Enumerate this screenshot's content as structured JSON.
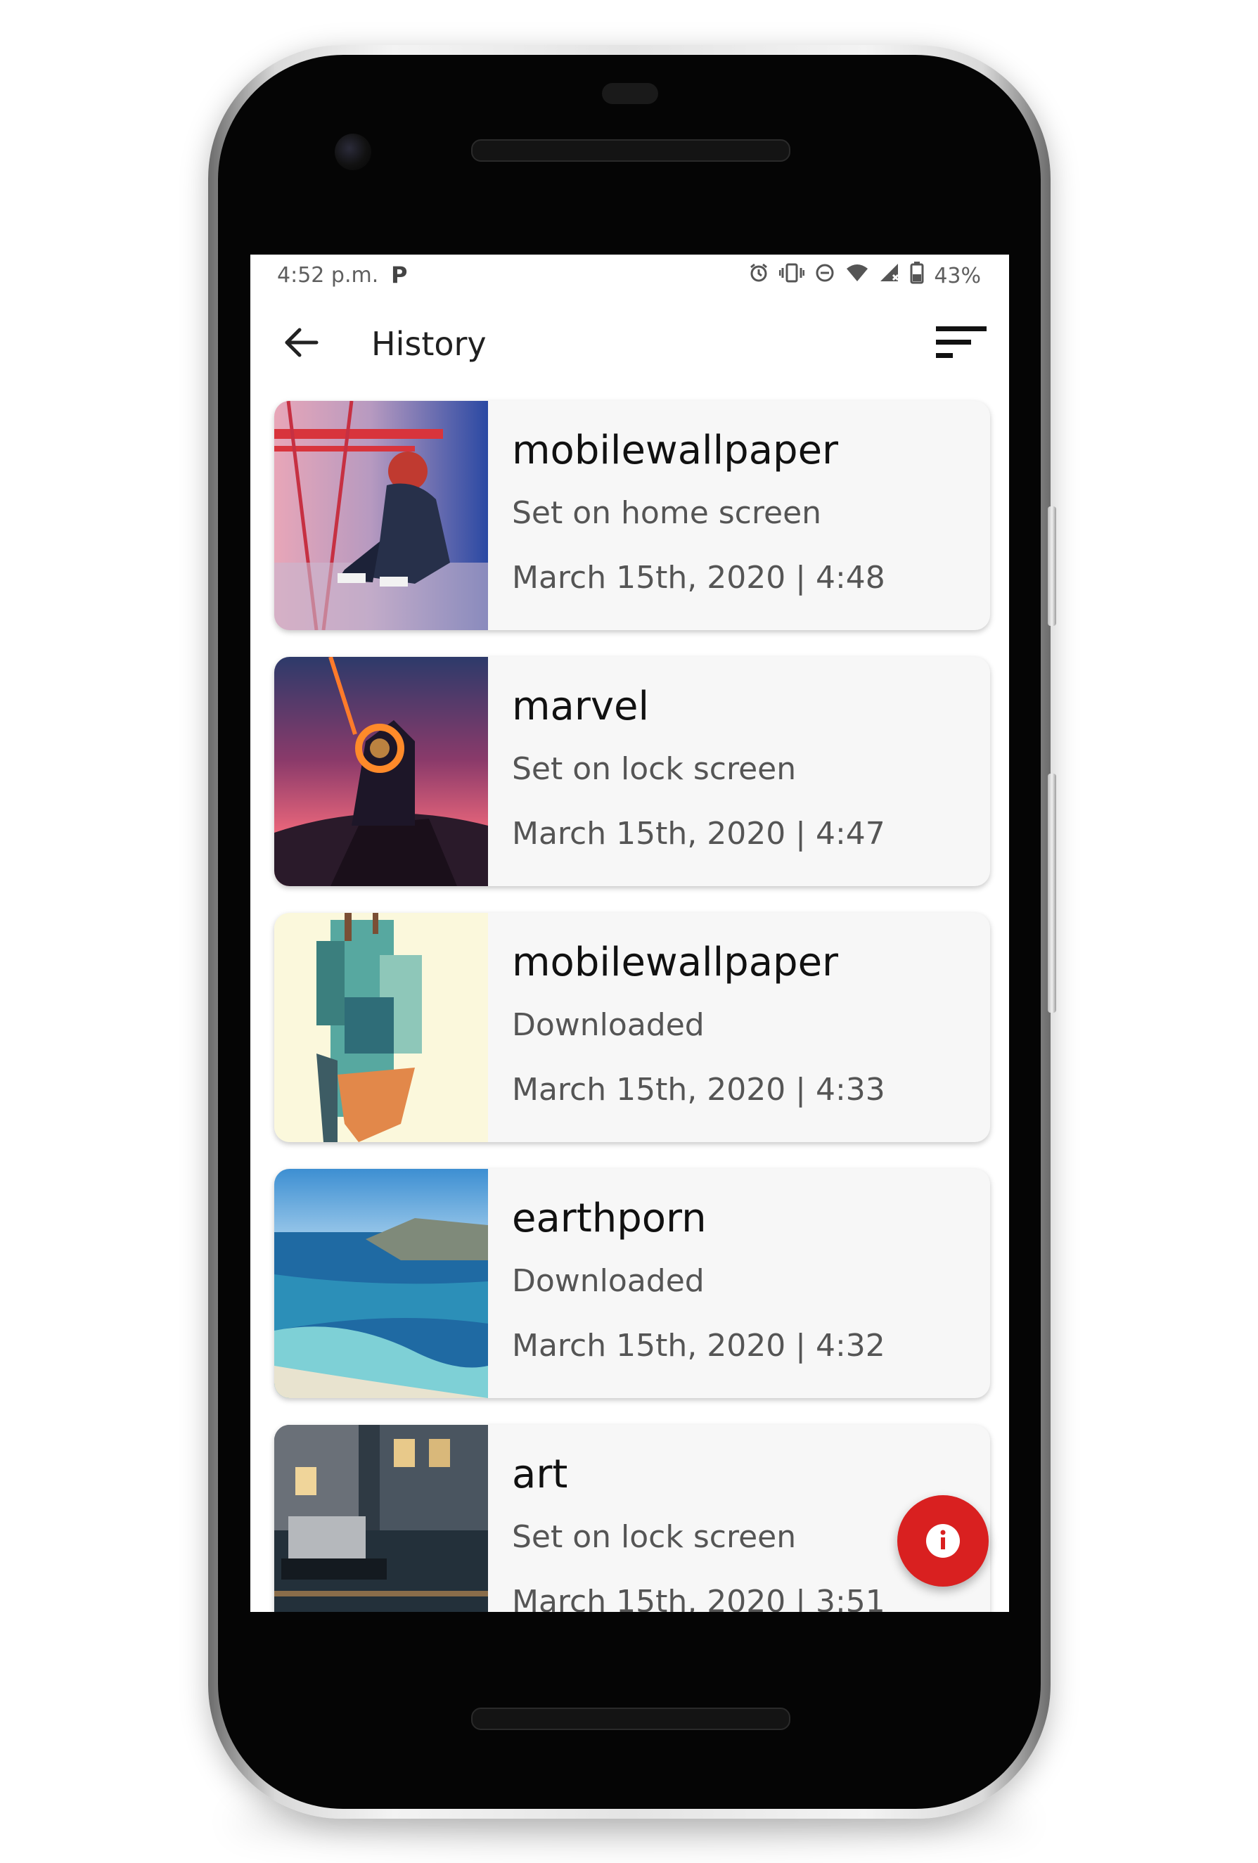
{
  "status_bar": {
    "time": "4:52 p.m.",
    "notification_icon": "parking-p-icon",
    "icons": [
      "alarm-icon",
      "vibrate-icon",
      "do-not-disturb-icon",
      "wifi-icon",
      "cell-signal-icon",
      "battery-icon"
    ],
    "battery": "43%"
  },
  "toolbar": {
    "title": "History",
    "back_icon": "arrow-back-icon",
    "sort_icon": "sort-icon"
  },
  "history": [
    {
      "title": "mobilewallpaper",
      "action": "Set on home screen",
      "date": "March 15th, 2020 | 4:48"
    },
    {
      "title": "marvel",
      "action": "Set on lock screen",
      "date": "March 15th, 2020 | 4:47"
    },
    {
      "title": "mobilewallpaper",
      "action": "Downloaded",
      "date": "March 15th, 2020 | 4:33"
    },
    {
      "title": "earthporn",
      "action": "Downloaded",
      "date": "March 15th, 2020 | 4:32"
    },
    {
      "title": "art",
      "action": "Set on lock screen",
      "date": "March 15th, 2020 | 3:51"
    }
  ],
  "fab": {
    "icon": "info-icon"
  },
  "colors": {
    "accent": "#d92020",
    "card_bg": "#f7f7f7",
    "text_primary": "#111111",
    "text_secondary": "#555555"
  }
}
